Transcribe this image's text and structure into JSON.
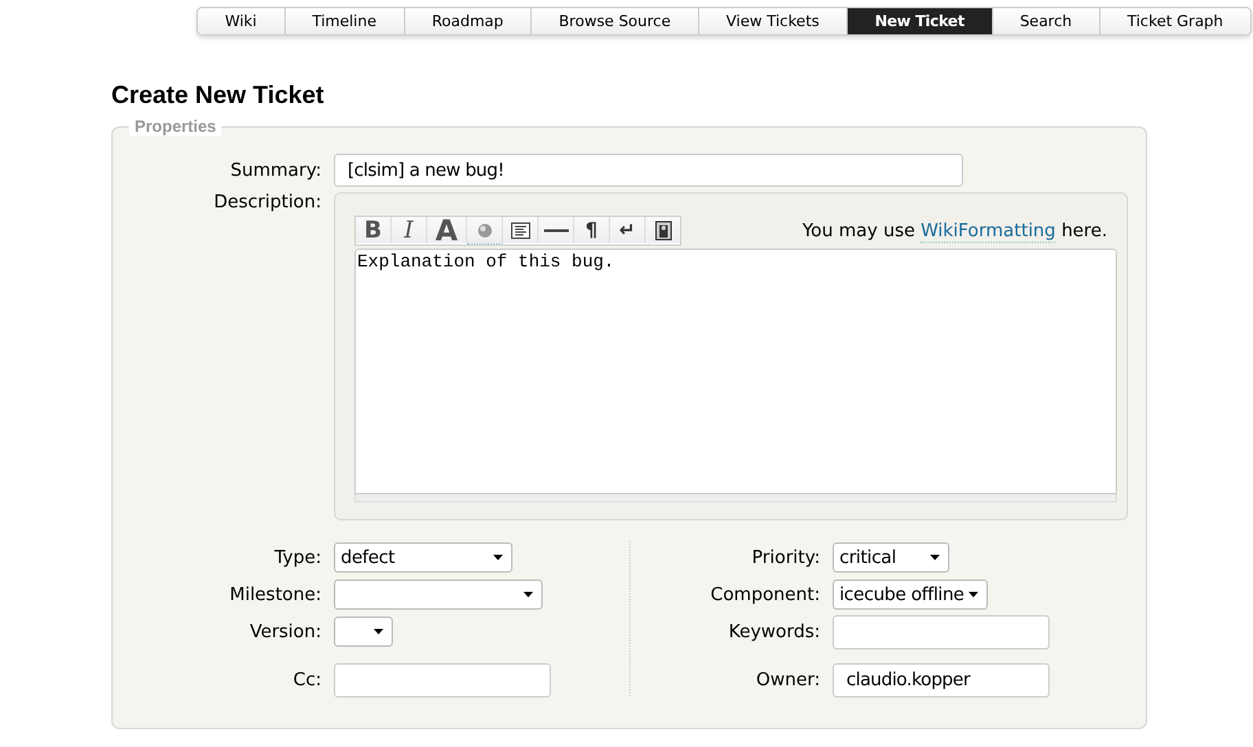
{
  "nav": [
    {
      "label": "Wiki",
      "selected": false
    },
    {
      "label": "Timeline",
      "selected": false
    },
    {
      "label": "Roadmap",
      "selected": false
    },
    {
      "label": "Browse Source",
      "selected": false
    },
    {
      "label": "View Tickets",
      "selected": false
    },
    {
      "label": "New Ticket",
      "selected": true
    },
    {
      "label": "Search",
      "selected": false
    },
    {
      "label": "Ticket Graph",
      "selected": false
    }
  ],
  "heading": "Create New Ticket",
  "properties": {
    "legend": "Properties",
    "summary": {
      "label": "Summary:",
      "value": "[clsim] a new bug!"
    },
    "description": {
      "label": "Description:",
      "hint_start": "You may use",
      "hint_link": "WikiFormatting",
      "hint_end": "here.",
      "value": "Explanation of this bug.",
      "toolbar": [
        {
          "kind": "bold",
          "label": "B"
        },
        {
          "kind": "italic",
          "label": "I"
        },
        {
          "kind": "heading",
          "label": "A"
        },
        {
          "kind": "link"
        },
        {
          "kind": "code"
        },
        {
          "kind": "rule"
        },
        {
          "kind": "paragraph",
          "label": "¶"
        },
        {
          "kind": "break",
          "label": "↵"
        },
        {
          "kind": "image"
        }
      ]
    },
    "left_fields": [
      {
        "label": "Type:",
        "kind": "select",
        "value": "defect"
      },
      {
        "label": "Milestone:",
        "kind": "select"
      },
      {
        "label": "Version:",
        "kind": "select"
      },
      {
        "label": "Cc:",
        "kind": "text"
      }
    ],
    "right_fields": [
      {
        "label": "Priority:",
        "kind": "select",
        "value": "critical"
      },
      {
        "label": "Component:",
        "kind": "select",
        "value": "icecube offline"
      },
      {
        "label": "Keywords:",
        "kind": "text"
      },
      {
        "label": "Owner:",
        "kind": "text",
        "value": "claudio.kopper"
      }
    ]
  }
}
